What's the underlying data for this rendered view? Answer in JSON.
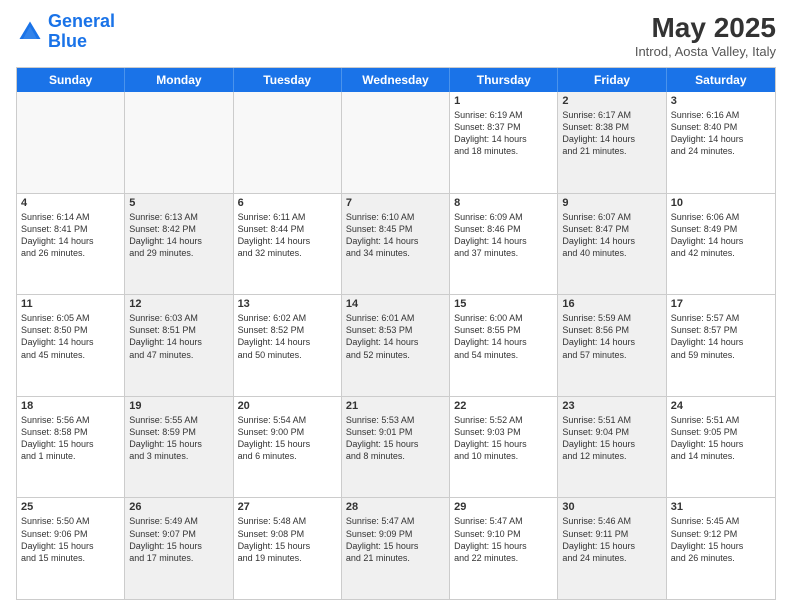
{
  "header": {
    "logo_line1": "General",
    "logo_line2": "Blue",
    "title": "May 2025",
    "subtitle": "Introd, Aosta Valley, Italy"
  },
  "days_of_week": [
    "Sunday",
    "Monday",
    "Tuesday",
    "Wednesday",
    "Thursday",
    "Friday",
    "Saturday"
  ],
  "weeks": [
    [
      {
        "day": "",
        "info": "",
        "empty": true
      },
      {
        "day": "",
        "info": "",
        "empty": true
      },
      {
        "day": "",
        "info": "",
        "empty": true
      },
      {
        "day": "",
        "info": "",
        "empty": true
      },
      {
        "day": "1",
        "info": "Sunrise: 6:19 AM\nSunset: 8:37 PM\nDaylight: 14 hours\nand 18 minutes."
      },
      {
        "day": "2",
        "info": "Sunrise: 6:17 AM\nSunset: 8:38 PM\nDaylight: 14 hours\nand 21 minutes.",
        "shaded": true
      },
      {
        "day": "3",
        "info": "Sunrise: 6:16 AM\nSunset: 8:40 PM\nDaylight: 14 hours\nand 24 minutes."
      }
    ],
    [
      {
        "day": "4",
        "info": "Sunrise: 6:14 AM\nSunset: 8:41 PM\nDaylight: 14 hours\nand 26 minutes."
      },
      {
        "day": "5",
        "info": "Sunrise: 6:13 AM\nSunset: 8:42 PM\nDaylight: 14 hours\nand 29 minutes.",
        "shaded": true
      },
      {
        "day": "6",
        "info": "Sunrise: 6:11 AM\nSunset: 8:44 PM\nDaylight: 14 hours\nand 32 minutes."
      },
      {
        "day": "7",
        "info": "Sunrise: 6:10 AM\nSunset: 8:45 PM\nDaylight: 14 hours\nand 34 minutes.",
        "shaded": true
      },
      {
        "day": "8",
        "info": "Sunrise: 6:09 AM\nSunset: 8:46 PM\nDaylight: 14 hours\nand 37 minutes."
      },
      {
        "day": "9",
        "info": "Sunrise: 6:07 AM\nSunset: 8:47 PM\nDaylight: 14 hours\nand 40 minutes.",
        "shaded": true
      },
      {
        "day": "10",
        "info": "Sunrise: 6:06 AM\nSunset: 8:49 PM\nDaylight: 14 hours\nand 42 minutes."
      }
    ],
    [
      {
        "day": "11",
        "info": "Sunrise: 6:05 AM\nSunset: 8:50 PM\nDaylight: 14 hours\nand 45 minutes."
      },
      {
        "day": "12",
        "info": "Sunrise: 6:03 AM\nSunset: 8:51 PM\nDaylight: 14 hours\nand 47 minutes.",
        "shaded": true
      },
      {
        "day": "13",
        "info": "Sunrise: 6:02 AM\nSunset: 8:52 PM\nDaylight: 14 hours\nand 50 minutes."
      },
      {
        "day": "14",
        "info": "Sunrise: 6:01 AM\nSunset: 8:53 PM\nDaylight: 14 hours\nand 52 minutes.",
        "shaded": true
      },
      {
        "day": "15",
        "info": "Sunrise: 6:00 AM\nSunset: 8:55 PM\nDaylight: 14 hours\nand 54 minutes."
      },
      {
        "day": "16",
        "info": "Sunrise: 5:59 AM\nSunset: 8:56 PM\nDaylight: 14 hours\nand 57 minutes.",
        "shaded": true
      },
      {
        "day": "17",
        "info": "Sunrise: 5:57 AM\nSunset: 8:57 PM\nDaylight: 14 hours\nand 59 minutes."
      }
    ],
    [
      {
        "day": "18",
        "info": "Sunrise: 5:56 AM\nSunset: 8:58 PM\nDaylight: 15 hours\nand 1 minute."
      },
      {
        "day": "19",
        "info": "Sunrise: 5:55 AM\nSunset: 8:59 PM\nDaylight: 15 hours\nand 3 minutes.",
        "shaded": true
      },
      {
        "day": "20",
        "info": "Sunrise: 5:54 AM\nSunset: 9:00 PM\nDaylight: 15 hours\nand 6 minutes."
      },
      {
        "day": "21",
        "info": "Sunrise: 5:53 AM\nSunset: 9:01 PM\nDaylight: 15 hours\nand 8 minutes.",
        "shaded": true
      },
      {
        "day": "22",
        "info": "Sunrise: 5:52 AM\nSunset: 9:03 PM\nDaylight: 15 hours\nand 10 minutes."
      },
      {
        "day": "23",
        "info": "Sunrise: 5:51 AM\nSunset: 9:04 PM\nDaylight: 15 hours\nand 12 minutes.",
        "shaded": true
      },
      {
        "day": "24",
        "info": "Sunrise: 5:51 AM\nSunset: 9:05 PM\nDaylight: 15 hours\nand 14 minutes."
      }
    ],
    [
      {
        "day": "25",
        "info": "Sunrise: 5:50 AM\nSunset: 9:06 PM\nDaylight: 15 hours\nand 15 minutes."
      },
      {
        "day": "26",
        "info": "Sunrise: 5:49 AM\nSunset: 9:07 PM\nDaylight: 15 hours\nand 17 minutes.",
        "shaded": true
      },
      {
        "day": "27",
        "info": "Sunrise: 5:48 AM\nSunset: 9:08 PM\nDaylight: 15 hours\nand 19 minutes."
      },
      {
        "day": "28",
        "info": "Sunrise: 5:47 AM\nSunset: 9:09 PM\nDaylight: 15 hours\nand 21 minutes.",
        "shaded": true
      },
      {
        "day": "29",
        "info": "Sunrise: 5:47 AM\nSunset: 9:10 PM\nDaylight: 15 hours\nand 22 minutes."
      },
      {
        "day": "30",
        "info": "Sunrise: 5:46 AM\nSunset: 9:11 PM\nDaylight: 15 hours\nand 24 minutes.",
        "shaded": true
      },
      {
        "day": "31",
        "info": "Sunrise: 5:45 AM\nSunset: 9:12 PM\nDaylight: 15 hours\nand 26 minutes."
      }
    ]
  ]
}
